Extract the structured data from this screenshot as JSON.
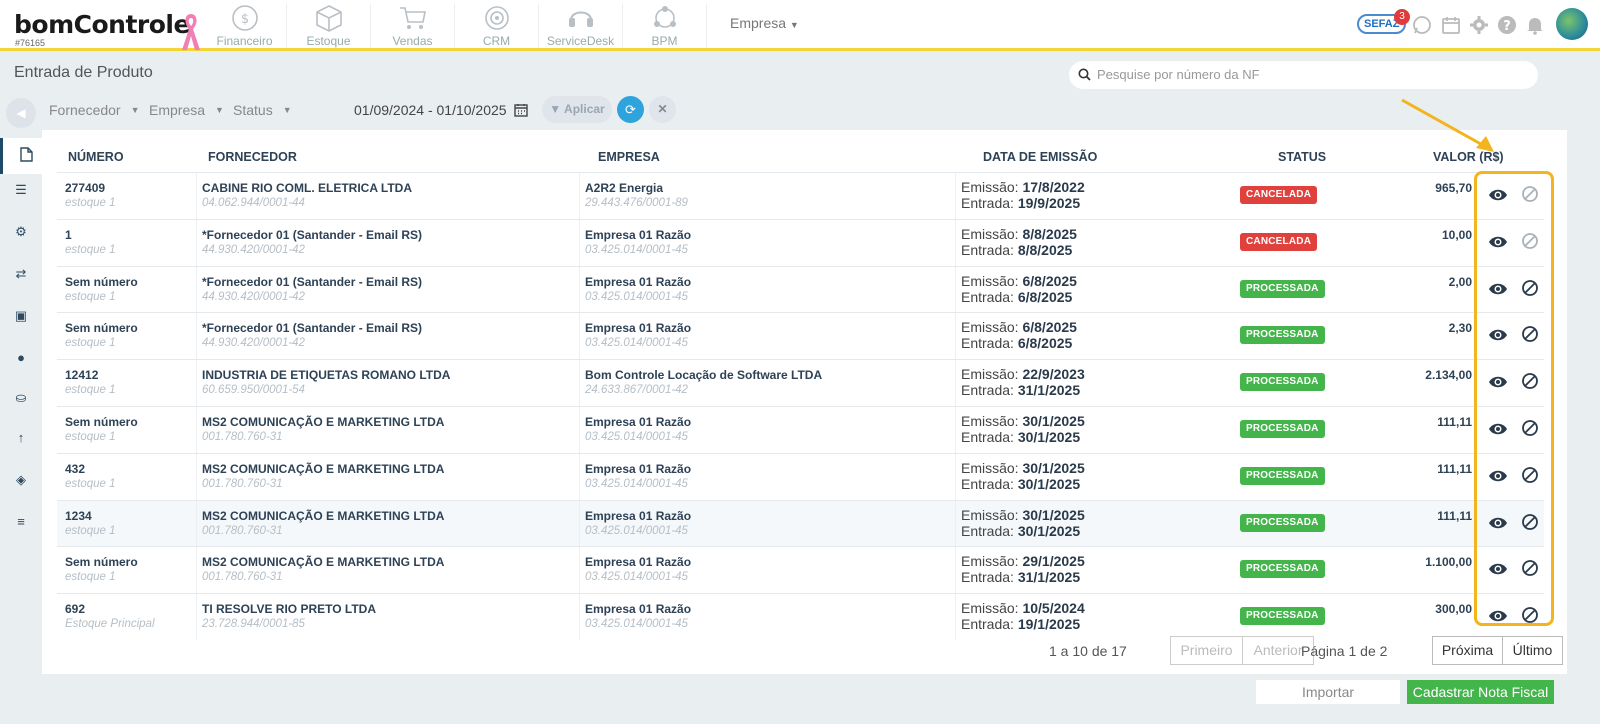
{
  "header": {
    "logo": "bomControle",
    "account_id": "#76165",
    "modules": [
      {
        "label": "Financeiro",
        "icon": "dollar-coin-icon"
      },
      {
        "label": "Estoque",
        "icon": "box-icon"
      },
      {
        "label": "Vendas",
        "icon": "cart-icon"
      },
      {
        "label": "CRM",
        "icon": "target-icon"
      },
      {
        "label": "ServiceDesk",
        "icon": "headset-icon"
      },
      {
        "label": "BPM",
        "icon": "network-icon"
      }
    ],
    "empresa_menu": "Empresa",
    "sefaz_label": "SEFAZ",
    "sefaz_badge": "3"
  },
  "page": {
    "title": "Entrada de Produto",
    "search_placeholder": "Pesquise por número da NF"
  },
  "filters": {
    "fornecedor": "Fornecedor",
    "empresa": "Empresa",
    "status": "Status",
    "date_range": "01/09/2024 - 01/10/2025",
    "aplicar": "Aplicar"
  },
  "table": {
    "headers": [
      "NÚMERO",
      "FORNECEDOR",
      "EMPRESA",
      "DATA DE EMISSÃO",
      "STATUS",
      "VALOR (R$)"
    ],
    "emissao_prefix": "Emissão:",
    "entrada_prefix": "Entrada:",
    "rows": [
      {
        "numero": "277409",
        "estoque": "estoque 1",
        "fornecedor": "CABINE RIO COML. ELETRICA LTDA",
        "fornecedor_doc": "04.062.944/0001-44",
        "empresa": "A2R2 Energia",
        "empresa_doc": "29.443.476/0001-89",
        "emissao": "17/8/2022",
        "entrada": "19/9/2025",
        "status": "CANCELADA",
        "valor": "965,70"
      },
      {
        "numero": "1",
        "estoque": "estoque 1",
        "fornecedor": "*Fornecedor 01 (Santander - Email RS)",
        "fornecedor_doc": "44.930.420/0001-42",
        "empresa": "Empresa 01 Razão",
        "empresa_doc": "03.425.014/0001-45",
        "emissao": "8/8/2025",
        "entrada": "8/8/2025",
        "status": "CANCELADA",
        "valor": "10,00"
      },
      {
        "numero": "Sem número",
        "estoque": "estoque 1",
        "fornecedor": "*Fornecedor 01 (Santander - Email RS)",
        "fornecedor_doc": "44.930.420/0001-42",
        "empresa": "Empresa 01 Razão",
        "empresa_doc": "03.425.014/0001-45",
        "emissao": "6/8/2025",
        "entrada": "6/8/2025",
        "status": "PROCESSADA",
        "valor": "2,00"
      },
      {
        "numero": "Sem número",
        "estoque": "estoque 1",
        "fornecedor": "*Fornecedor 01 (Santander - Email RS)",
        "fornecedor_doc": "44.930.420/0001-42",
        "empresa": "Empresa 01 Razão",
        "empresa_doc": "03.425.014/0001-45",
        "emissao": "6/8/2025",
        "entrada": "6/8/2025",
        "status": "PROCESSADA",
        "valor": "2,30"
      },
      {
        "numero": "12412",
        "estoque": "estoque 1",
        "fornecedor": "INDUSTRIA DE ETIQUETAS ROMANO LTDA",
        "fornecedor_doc": "60.659.950/0001-54",
        "empresa": "Bom Controle Locação de Software LTDA",
        "empresa_doc": "24.633.867/0001-42",
        "emissao": "22/9/2023",
        "entrada": "31/1/2025",
        "status": "PROCESSADA",
        "valor": "2.134,00"
      },
      {
        "numero": "Sem número",
        "estoque": "estoque 1",
        "fornecedor": "MS2 COMUNICAÇÃO E MARKETING LTDA",
        "fornecedor_doc": "001.780.760-31",
        "empresa": "Empresa 01 Razão",
        "empresa_doc": "03.425.014/0001-45",
        "emissao": "30/1/2025",
        "entrada": "30/1/2025",
        "status": "PROCESSADA",
        "valor": "111,11"
      },
      {
        "numero": "432",
        "estoque": "estoque 1",
        "fornecedor": "MS2 COMUNICAÇÃO E MARKETING LTDA",
        "fornecedor_doc": "001.780.760-31",
        "empresa": "Empresa 01 Razão",
        "empresa_doc": "03.425.014/0001-45",
        "emissao": "30/1/2025",
        "entrada": "30/1/2025",
        "status": "PROCESSADA",
        "valor": "111,11"
      },
      {
        "numero": "1234",
        "estoque": "estoque 1",
        "fornecedor": "MS2 COMUNICAÇÃO E MARKETING LTDA",
        "fornecedor_doc": "001.780.760-31",
        "empresa": "Empresa 01 Razão",
        "empresa_doc": "03.425.014/0001-45",
        "emissao": "30/1/2025",
        "entrada": "30/1/2025",
        "status": "PROCESSADA",
        "valor": "111,11"
      },
      {
        "numero": "Sem número",
        "estoque": "estoque 1",
        "fornecedor": "MS2 COMUNICAÇÃO E MARKETING LTDA",
        "fornecedor_doc": "001.780.760-31",
        "empresa": "Empresa 01 Razão",
        "empresa_doc": "03.425.014/0001-45",
        "emissao": "29/1/2025",
        "entrada": "31/1/2025",
        "status": "PROCESSADA",
        "valor": "1.100,00"
      },
      {
        "numero": "692",
        "estoque": "Estoque Principal",
        "fornecedor": "TI RESOLVE RIO PRETO LTDA",
        "fornecedor_doc": "23.728.944/0001-85",
        "empresa": "Empresa 01 Razão",
        "empresa_doc": "03.425.014/0001-45",
        "emissao": "10/5/2024",
        "entrada": "19/1/2025",
        "status": "PROCESSADA",
        "valor": "300,00"
      }
    ]
  },
  "pagination": {
    "info": "1 a 10 de 17",
    "primeiro": "Primeiro",
    "anterior": "Anterior",
    "pagina": "Página 1 de 2",
    "proxima": "Próxima",
    "ultimo": "Último"
  },
  "footer": {
    "importar": "Importar",
    "cadastrar": "Cadastrar Nota Fiscal"
  },
  "colors": {
    "accent_yellow": "#f2d638",
    "cancel_red": "#e0413d",
    "processed_green": "#44b54b",
    "refresh_blue": "#2fa3dc",
    "highlight_orange": "#f3b41e"
  }
}
